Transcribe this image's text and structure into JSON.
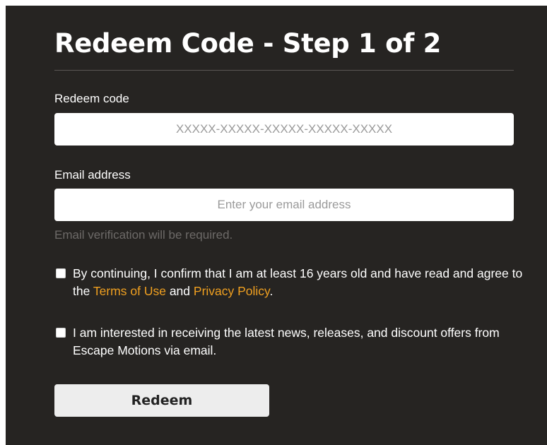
{
  "form": {
    "title": "Redeem Code - Step 1 of 2",
    "code": {
      "label": "Redeem code",
      "placeholder": "XXXXX-XXXXX-XXXXX-XXXXX-XXXXX",
      "value": ""
    },
    "email": {
      "label": "Email address",
      "placeholder": "Enter your email address",
      "value": "",
      "hint": "Email verification will be required."
    },
    "consent": {
      "checked": false,
      "text_before": "By continuing, I confirm that I am at least 16 years old and have read and agree to the ",
      "terms_link": "Terms of Use",
      "text_between": " and ",
      "privacy_link": "Privacy Policy",
      "text_after": "."
    },
    "newsletter": {
      "checked": false,
      "text": "I am interested in receiving the latest news, releases, and discount offers from Escape Motions via email."
    },
    "submit_label": "Redeem"
  },
  "colors": {
    "panel_background": "#262422",
    "link": "#f0a020",
    "hint_text": "#6d6a68",
    "button_background": "#ededed"
  }
}
